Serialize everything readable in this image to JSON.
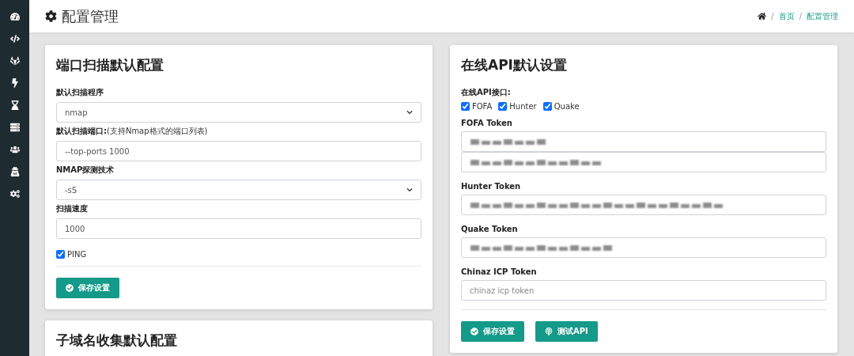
{
  "page": {
    "title": "配置管理",
    "breadcrumb": [
      {
        "separator": "/",
        "label": "首页"
      },
      {
        "separator": "/",
        "label": "配置管理"
      }
    ]
  },
  "port_scan": {
    "title": "端口扫描默认配置",
    "fields": [
      {
        "kind": "select",
        "label": "默认扫描程序",
        "value": "nmap"
      },
      {
        "kind": "text",
        "label": "默认扫描端口:",
        "hint": "(支持Nmap格式的端口列表)",
        "value": "--top-ports 1000"
      },
      {
        "kind": "select",
        "label": "NMAP探测技术",
        "value": "-sS"
      },
      {
        "kind": "text",
        "label": "扫描速度",
        "value": "1000"
      }
    ],
    "ping": {
      "label": "PING",
      "checked": true
    },
    "buttons": [
      {
        "label": "保存设置",
        "kind": "save"
      }
    ]
  },
  "subdomain": {
    "title": "子域名收集默认配置"
  },
  "online_api": {
    "title": "在线API默认设置",
    "api_label": "在线API接口:",
    "apis": [
      {
        "label": "FOFA",
        "checked": true
      },
      {
        "label": "Hunter",
        "checked": true
      },
      {
        "label": "Quake",
        "checked": true
      }
    ],
    "tokens": [
      {
        "label": "FOFA Token",
        "inputs": [
          {
            "kind": "blurred"
          },
          {
            "kind": "blurred"
          }
        ]
      },
      {
        "label": "Hunter Token",
        "inputs": [
          {
            "kind": "blurred"
          }
        ]
      },
      {
        "label": "Quake Token",
        "inputs": [
          {
            "kind": "blurred"
          }
        ]
      },
      {
        "label": "Chinaz ICP Token",
        "inputs": [
          {
            "kind": "empty",
            "placeholder": "chinaz icp token"
          }
        ]
      }
    ],
    "buttons": [
      {
        "label": "保存设置",
        "kind": "save"
      },
      {
        "label": "测试API",
        "kind": "test"
      }
    ]
  }
}
